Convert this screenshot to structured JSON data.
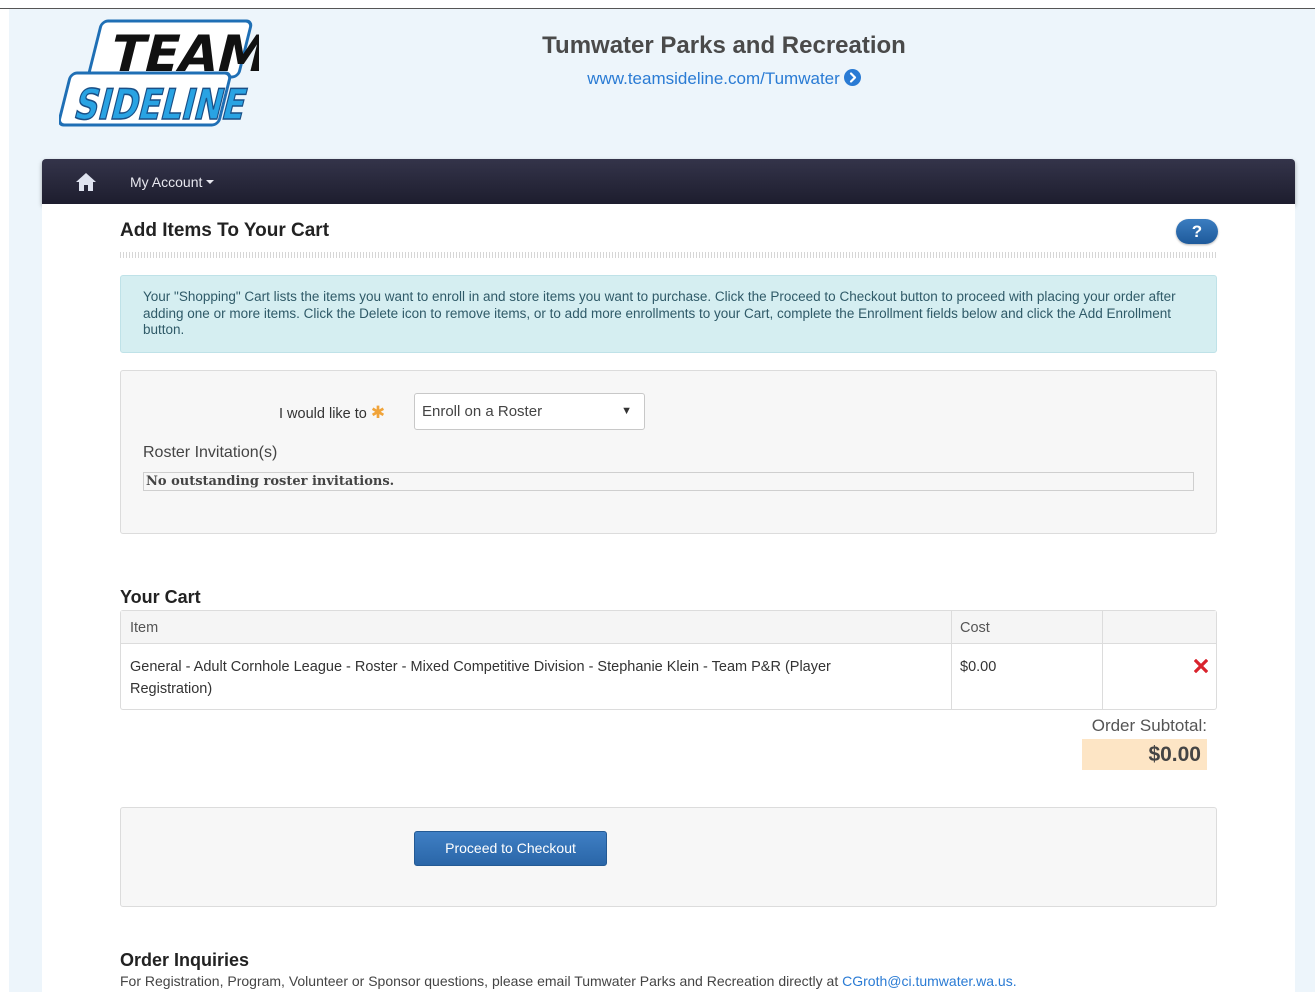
{
  "header": {
    "logo_text_line1": "TEAM",
    "logo_text_line2": "SIDELINE",
    "org_title": "Tumwater Parks and Recreation",
    "org_url": "www.teamsideline.com/Tumwater"
  },
  "navbar": {
    "home_icon": "home-icon",
    "account_label": "My Account"
  },
  "page": {
    "title": "Add Items To Your Cart",
    "help_label": "?",
    "info_text": "Your \"Shopping\" Cart lists the items you want to enroll in and store items you want to purchase. Click the Proceed to Checkout button to proceed with placing your order after adding one or more items. Click the Delete icon to remove items, or to add more enrollments to your Cart, complete the Enrollment fields below and click the Add Enrollment button."
  },
  "form": {
    "like_label": "I would like to",
    "required_marker": "✱",
    "select_value": "Enroll on a Roster",
    "roster_label": "Roster Invitation(s)",
    "roster_message": "No outstanding roster invitations."
  },
  "cart": {
    "title": "Your Cart",
    "columns": [
      "Item",
      "Cost",
      ""
    ],
    "rows": [
      {
        "item": "General - Adult Cornhole League - Roster - Mixed Competitive Division - Stephanie Klein - Team P&R (Player Registration)",
        "cost": "$0.00"
      }
    ],
    "subtotal_label": "Order Subtotal:",
    "subtotal_value": "$0.00",
    "checkout_label": "Proceed to Checkout"
  },
  "inquiries": {
    "title": "Order Inquiries",
    "text": "For Registration, Program, Volunteer or Sponsor questions, please email Tumwater Parks and Recreation directly at ",
    "email": "CGroth@ci.tumwater.wa.us."
  },
  "colors": {
    "navbar": "#1d1d2e",
    "link": "#2a7bd4",
    "info_bg": "#d5eef1",
    "subtotal_bg": "#fde5c5",
    "button": "#2a66a8",
    "delete": "#d9232d"
  }
}
